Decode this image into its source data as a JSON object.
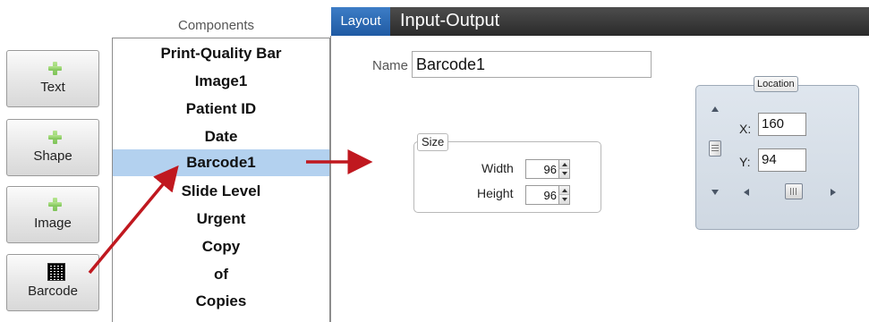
{
  "toolbox": {
    "buttons": [
      {
        "label": "Text",
        "icon": "plus-icon"
      },
      {
        "label": "Shape",
        "icon": "plus-icon"
      },
      {
        "label": "Image",
        "icon": "plus-icon"
      },
      {
        "label": "Barcode",
        "icon": "barcode-icon"
      }
    ]
  },
  "components": {
    "title": "Components",
    "items": [
      "Print-Quality Bar",
      "Image1",
      "Patient ID",
      "Date",
      "Barcode1",
      "Slide Level",
      "Urgent",
      "Copy",
      "of",
      "Copies"
    ],
    "selected": "Barcode1"
  },
  "tabs": {
    "active": "Layout",
    "other": "Input-Output"
  },
  "layout": {
    "name_label": "Name",
    "name_value": "Barcode1",
    "size": {
      "legend": "Size",
      "width_label": "Width",
      "width_value": "96",
      "height_label": "Height",
      "height_value": "96"
    },
    "location": {
      "legend": "Location",
      "x_label": "X:",
      "x_value": "160",
      "y_label": "Y:",
      "y_value": "94"
    }
  },
  "colors": {
    "selected_row": "#b3d1ef",
    "tab_active": "#2d6db8",
    "arrow": "#c0181f",
    "plus_icon": "#8fcd63"
  }
}
